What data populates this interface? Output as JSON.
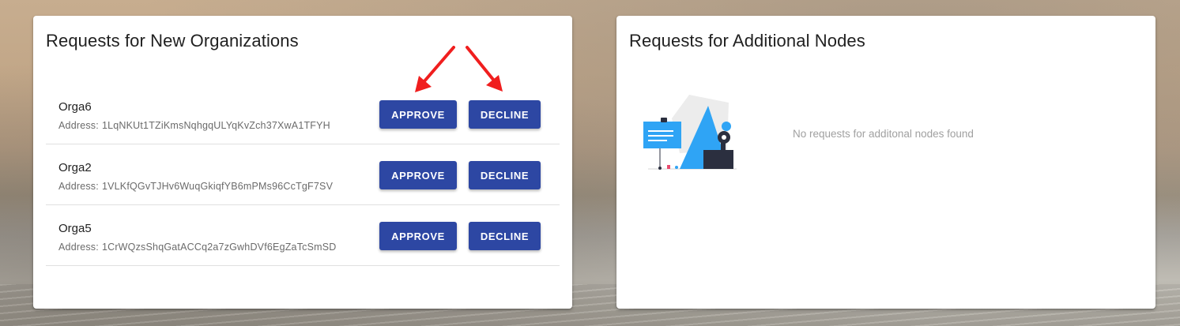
{
  "organizations_panel": {
    "title": "Requests for New Organizations",
    "address_label": "Address:",
    "approve_label": "APPROVE",
    "decline_label": "DECLINE",
    "requests": [
      {
        "name": "Orga6",
        "address": "1LqNKUt1TZiKmsNqhgqULYqKvZch37XwA1TFYH"
      },
      {
        "name": "Orga2",
        "address": "1VLKfQGvTJHv6WuqGkiqfYB6mPMs96CcTgF7SV"
      },
      {
        "name": "Orga5",
        "address": "1CrWQzsShqGatACCq2a7zGwhDVf6EgZaTcSmSD"
      }
    ]
  },
  "nodes_panel": {
    "title": "Requests for Additional Nodes",
    "empty_message": "No requests for additonal nodes found",
    "illustration": "empty-state-illustration"
  },
  "colors": {
    "button_primary": "#2d47a3",
    "annotation_arrow": "#f01e1e",
    "illustration_blue": "#2fa4f5"
  }
}
